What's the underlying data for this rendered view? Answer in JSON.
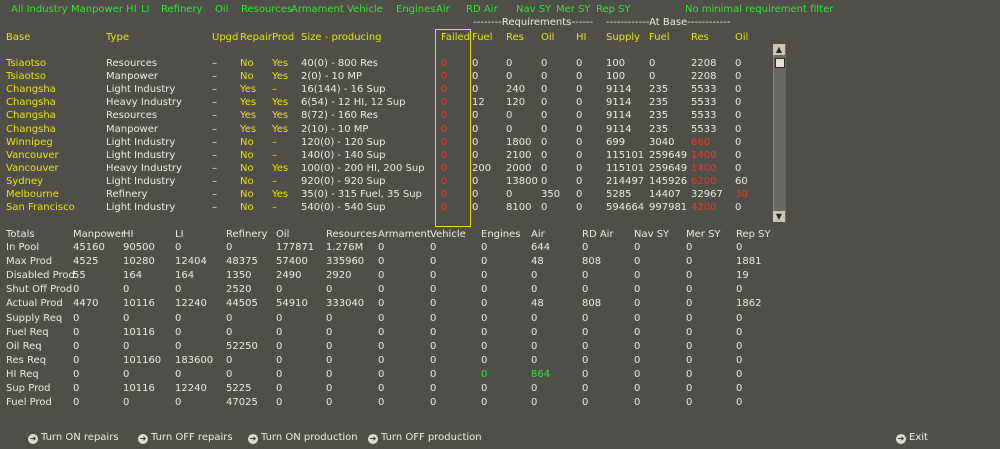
{
  "filters": [
    "All Industry",
    "Manpower HI",
    "LI",
    "Refinery",
    "Oil",
    "Resources",
    "Armament",
    "Vehicle",
    "Engines",
    "Air",
    "RD Air",
    "Nav SY",
    "Mer SY",
    "Rep SY",
    "No minimal requirement filter"
  ],
  "group_headers": {
    "requirements": "--------Requirements------",
    "at_base": "------------At Base------------"
  },
  "columns": [
    "Base",
    "Type",
    "Upgd",
    "Repair",
    "Prod",
    "Size - producing",
    "Failed",
    "Fuel",
    "Res",
    "Oil",
    "HI",
    "Supply",
    "Fuel",
    "Res",
    "Oil"
  ],
  "rows": [
    [
      "Tsiaotso",
      "Resources",
      "–",
      "No",
      "Yes",
      "40(0) - 800 Res",
      "0",
      "0",
      "0",
      "0",
      "0",
      "100",
      "0",
      "2208",
      "0"
    ],
    [
      "Tsiaotso",
      "Manpower",
      "–",
      "No",
      "Yes",
      "2(0) - 10 MP",
      "0",
      "0",
      "0",
      "0",
      "0",
      "100",
      "0",
      "2208",
      "0"
    ],
    [
      "Changsha",
      "Light Industry",
      "–",
      "Yes",
      "–",
      "16(144) - 16 Sup",
      "0",
      "0",
      "240",
      "0",
      "0",
      "9114",
      "235",
      "5533",
      "0"
    ],
    [
      "Changsha",
      "Heavy Industry",
      "–",
      "Yes",
      "Yes",
      "6(54) - 12 HI, 12 Sup",
      "0",
      "12",
      "120",
      "0",
      "0",
      "9114",
      "235",
      "5533",
      "0"
    ],
    [
      "Changsha",
      "Resources",
      "–",
      "Yes",
      "Yes",
      "8(72) - 160 Res",
      "0",
      "0",
      "0",
      "0",
      "0",
      "9114",
      "235",
      "5533",
      "0"
    ],
    [
      "Changsha",
      "Manpower",
      "–",
      "Yes",
      "Yes",
      "2(10) - 10 MP",
      "0",
      "0",
      "0",
      "0",
      "0",
      "9114",
      "235",
      "5533",
      "0"
    ],
    [
      "Winnipeg",
      "Light Industry",
      "–",
      "No",
      "–",
      "120(0) - 120 Sup",
      "0",
      "0",
      "1800",
      "0",
      "0",
      "699",
      "3040",
      "660",
      "0"
    ],
    [
      "Vancouver",
      "Light Industry",
      "–",
      "No",
      "–",
      "140(0) - 140 Sup",
      "0",
      "0",
      "2100",
      "0",
      "0",
      "115101",
      "259649",
      "1400",
      "0"
    ],
    [
      "Vancouver",
      "Heavy Industry",
      "–",
      "No",
      "Yes",
      "100(0) - 200 HI, 200 Sup",
      "0",
      "200",
      "2000",
      "0",
      "0",
      "115101",
      "259649",
      "1400",
      "0"
    ],
    [
      "Sydney",
      "Light Industry",
      "–",
      "No",
      "–",
      "920(0) - 920 Sup",
      "0",
      "0",
      "13800",
      "0",
      "0",
      "214497",
      "145926",
      "6200",
      "60"
    ],
    [
      "Melbourne",
      "Refinery",
      "–",
      "No",
      "Yes",
      "35(0) - 315 Fuel, 35 Sup",
      "0",
      "0",
      "0",
      "350",
      "0",
      "5285",
      "14407",
      "32967",
      "30"
    ],
    [
      "San Francisco",
      "Light Industry",
      "–",
      "No",
      "–",
      "540(0) - 540 Sup",
      "0",
      "0",
      "8100",
      "0",
      "0",
      "594664",
      "997981",
      "4200",
      "0"
    ]
  ],
  "red_cells": [
    [
      6,
      13
    ],
    [
      7,
      13
    ],
    [
      8,
      13
    ],
    [
      9,
      13
    ],
    [
      10,
      14
    ],
    [
      11,
      13
    ]
  ],
  "totals_columns": [
    "Totals",
    "Manpower",
    "HI",
    "LI",
    "Refinery",
    "Oil",
    "Resources",
    "Armament",
    "Vehicle",
    "Engines",
    "Air",
    "RD Air",
    "Nav SY",
    "Mer SY",
    "Rep SY"
  ],
  "totals_rows": [
    [
      "In Pool",
      "45160",
      "90500",
      "0",
      "0",
      "177871",
      "1.276M",
      "0",
      "0",
      "0",
      "644",
      "0",
      "0",
      "0",
      "0"
    ],
    [
      "Max Prod",
      "4525",
      "10280",
      "12404",
      "48375",
      "57400",
      "335960",
      "0",
      "0",
      "0",
      "48",
      "808",
      "0",
      "0",
      "1881"
    ],
    [
      "Disabled Prod",
      "55",
      "164",
      "164",
      "1350",
      "2490",
      "2920",
      "0",
      "0",
      "0",
      "0",
      "0",
      "0",
      "0",
      "19"
    ],
    [
      "Shut Off Prod",
      "0",
      "0",
      "0",
      "2520",
      "0",
      "0",
      "0",
      "0",
      "0",
      "0",
      "0",
      "0",
      "0",
      "0"
    ],
    [
      "Actual Prod",
      "4470",
      "10116",
      "12240",
      "44505",
      "54910",
      "333040",
      "0",
      "0",
      "0",
      "48",
      "808",
      "0",
      "0",
      "1862"
    ],
    [
      "Supply Req",
      "0",
      "0",
      "0",
      "0",
      "0",
      "0",
      "0",
      "0",
      "0",
      "0",
      "0",
      "0",
      "0",
      "0"
    ],
    [
      "Fuel Req",
      "0",
      "10116",
      "0",
      "0",
      "0",
      "0",
      "0",
      "0",
      "0",
      "0",
      "0",
      "0",
      "0",
      "0"
    ],
    [
      "Oil Req",
      "0",
      "0",
      "0",
      "52250",
      "0",
      "0",
      "0",
      "0",
      "0",
      "0",
      "0",
      "0",
      "0",
      "0"
    ],
    [
      "Res Req",
      "0",
      "101160",
      "183600",
      "0",
      "0",
      "0",
      "0",
      "0",
      "0",
      "0",
      "0",
      "0",
      "0",
      "0"
    ],
    [
      "HI Req",
      "0",
      "0",
      "0",
      "0",
      "0",
      "0",
      "0",
      "0",
      "0",
      "864",
      "0",
      "0",
      "0",
      "0"
    ],
    [
      "Sup Prod",
      "0",
      "10116",
      "12240",
      "5225",
      "0",
      "0",
      "0",
      "0",
      "0",
      "0",
      "0",
      "0",
      "0",
      "0"
    ],
    [
      "Fuel Prod",
      "0",
      "0",
      "0",
      "47025",
      "0",
      "0",
      "0",
      "0",
      "0",
      "0",
      "0",
      "0",
      "0",
      "0"
    ]
  ],
  "green_total_cells": [
    [
      9,
      9
    ],
    [
      9,
      10
    ]
  ],
  "buttons": [
    "Turn ON repairs",
    "Turn OFF repairs",
    "Turn ON production",
    "Turn OFF production",
    "Exit"
  ],
  "colors": {
    "background": "#4f4e48",
    "header": "#e6e600",
    "highlight": "#33e633",
    "alert": "#e03a2a",
    "text": "#ededdf"
  }
}
